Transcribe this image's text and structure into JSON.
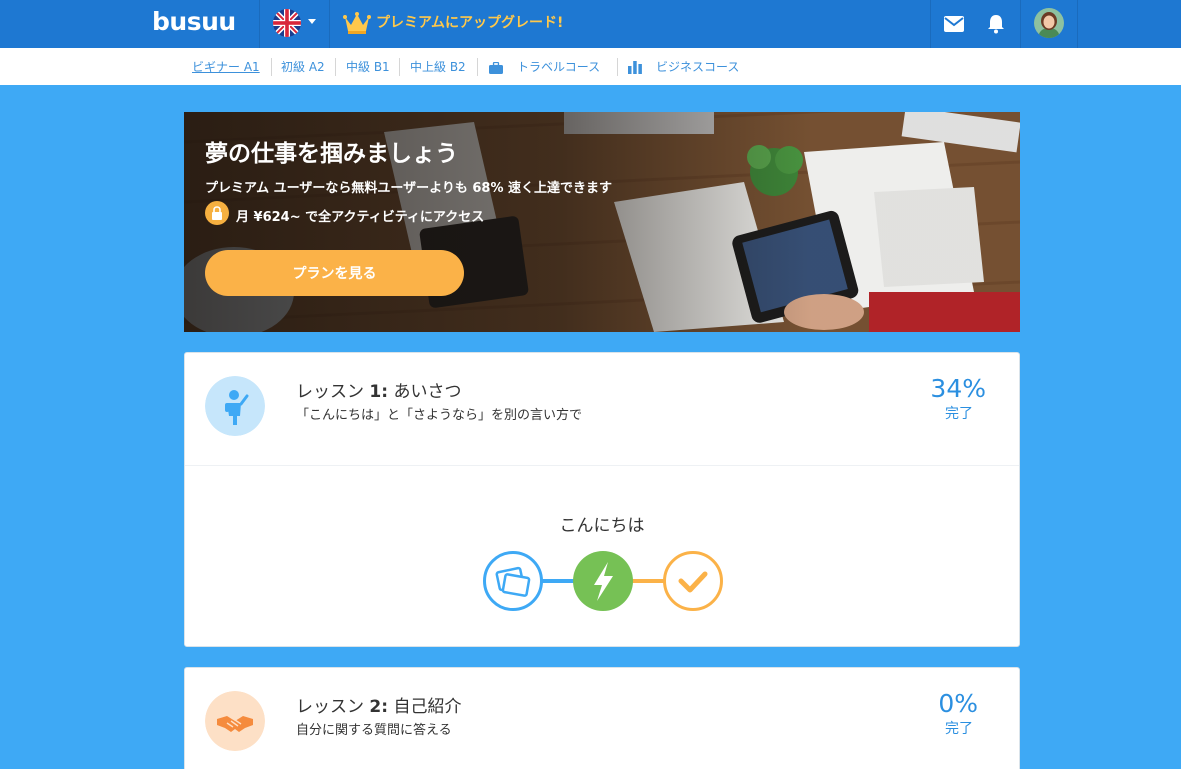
{
  "header": {
    "logo": "busuu",
    "premium_link": "プレミアムにアップグレード!",
    "language_icon": "uk-flag-icon",
    "icons": [
      "mail-icon",
      "bell-icon",
      "avatar"
    ]
  },
  "levels": {
    "items": [
      {
        "label": "ビギナー A1",
        "active": true
      },
      {
        "label": "初級 A2"
      },
      {
        "label": "中級 B1"
      },
      {
        "label": "中上級 B2"
      },
      {
        "label": "トラベルコース",
        "icon": "briefcase-icon"
      },
      {
        "label": "ビジネスコース",
        "icon": "bar-chart-icon"
      }
    ]
  },
  "banner": {
    "title": "夢の仕事を掴みましょう",
    "subtitle": "プレミアム ユーザーなら無料ユーザーよりも 68% 速く上達できます",
    "price": "月 ¥624~ で全アクティビティにアクセス",
    "button": "プランを見る"
  },
  "lessons": [
    {
      "title_prefix": "レッスン ",
      "title_num": "1:",
      "title_name": " あいさつ",
      "subtitle": "「こんにちは」と「さようなら」を別の言い方で",
      "percent": "34%",
      "percent_value": 34,
      "percent_label": "完了",
      "unit_title": "こんにちは",
      "steps": [
        "vocabulary-cards-icon",
        "lightning-icon",
        "checkmark-icon"
      ]
    },
    {
      "title_prefix": "レッスン ",
      "title_num": "2:",
      "title_name": " 自己紹介",
      "subtitle": "自分に関する質問に答える",
      "percent": "0%",
      "percent_value": 0,
      "percent_label": "完了"
    }
  ],
  "colors": {
    "header": "#1e78d2",
    "page_background": "#3ea9f5",
    "accent_blue": "#2b8fe0",
    "premium_gold": "#ffc84b",
    "button_orange": "#fbb248",
    "step_green": "#76c155"
  }
}
